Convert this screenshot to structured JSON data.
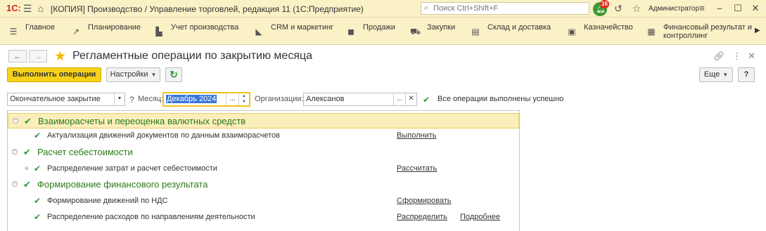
{
  "titlebar": {
    "logo": "1С:",
    "app_title": "[КОПИЯ] Производство / Управление торговлей, редакция 11  (1С:Предприятие)",
    "search_placeholder": "Поиск Ctrl+Shift+F",
    "notifications_count": "16",
    "user": "Администратор"
  },
  "sections": [
    {
      "label": "Главное",
      "icon": "menu-icon"
    },
    {
      "label": "Планирование",
      "icon": "chart-icon"
    },
    {
      "label": "Учет производства",
      "icon": "factory-icon"
    },
    {
      "label": "CRM и маркетинг",
      "icon": "megaphone-icon"
    },
    {
      "label": "Продажи",
      "icon": "bag-icon"
    },
    {
      "label": "Закупки",
      "icon": "cart-icon"
    },
    {
      "label": "Склад и доставка",
      "icon": "warehouse-icon"
    },
    {
      "label": "Казначейство",
      "icon": "bank-icon"
    },
    {
      "label": "Финансовый результат и контроллинг",
      "icon": "finance-icon"
    }
  ],
  "page": {
    "title": "Регламентные операции по закрытию месяца"
  },
  "toolbar": {
    "run_label": "Выполнить операции",
    "settings_label": "Настройки",
    "more_label": "Еще",
    "help_label": "?"
  },
  "filters": {
    "mode_value": "Окончательное закрытие",
    "month_label": "Месяц:",
    "month_value": "Декабрь 2024",
    "org_label": "Организации:",
    "org_value": "Алексанов",
    "status": "Все операции выполнены успешно"
  },
  "groups": [
    {
      "title": "Взаиморасчеты и переоценка валютных средств",
      "operations": [
        {
          "title": "Актуализация движений документов по данным взаиморасчетов",
          "actions": [
            "Выполнить"
          ]
        }
      ]
    },
    {
      "title": "Расчет себестоимости",
      "operations": [
        {
          "title": "Распределение затрат и расчет себестоимости",
          "actions": [
            "Рассчитать"
          ]
        }
      ]
    },
    {
      "title": "Формирование финансового результата",
      "operations": [
        {
          "title": "Формирование движений по НДС",
          "actions": [
            "Сформировать"
          ]
        },
        {
          "title": "Распределение расходов по направлениям деятельности",
          "actions": [
            "Распределить",
            "Подробнее"
          ]
        }
      ]
    }
  ]
}
